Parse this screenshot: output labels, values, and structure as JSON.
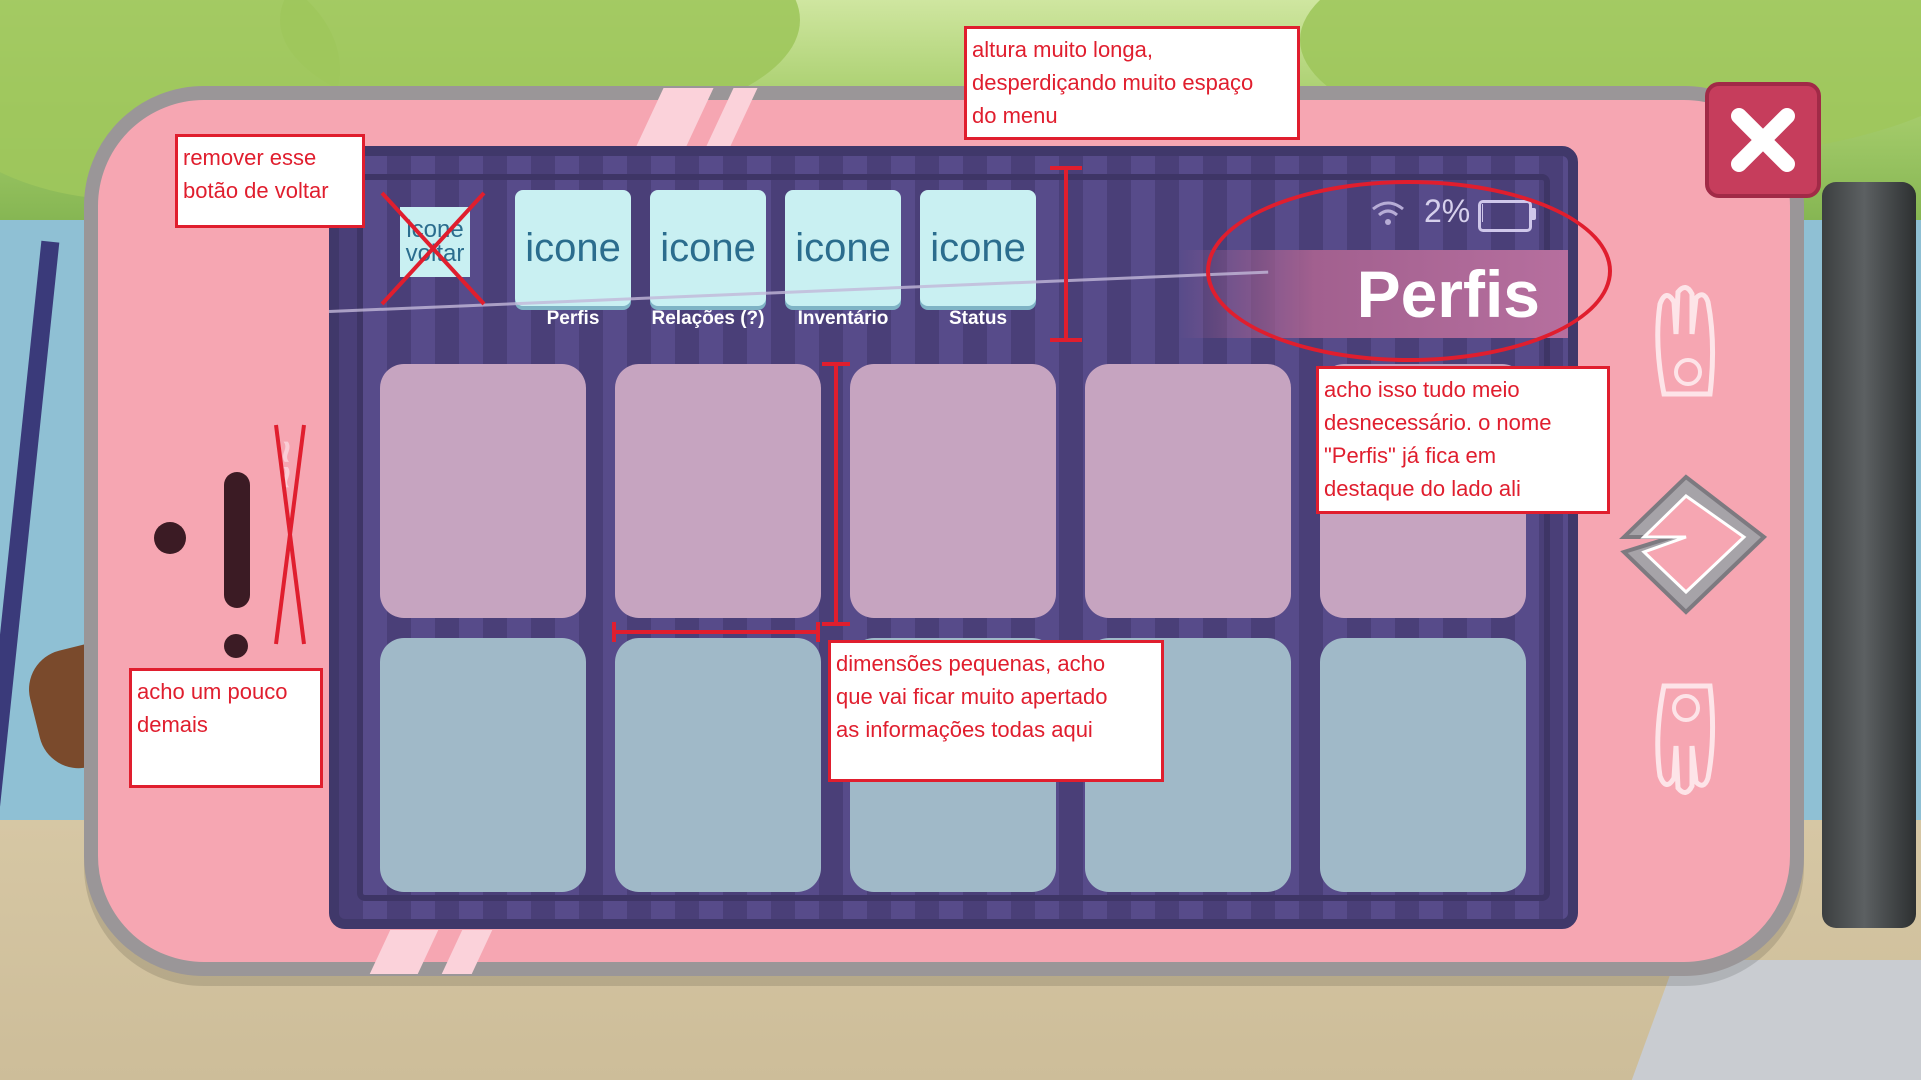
{
  "screen": {
    "back_button_label": "icone voltar",
    "tabs": [
      {
        "icon_text": "icone",
        "label": "Perfis"
      },
      {
        "icon_text": "icone",
        "label": "Relações (?)"
      },
      {
        "icon_text": "icone",
        "label": "Inventário"
      },
      {
        "icon_text": "icone",
        "label": "Status"
      }
    ],
    "battery_text": "2%",
    "battery_level": 0.02,
    "page_title": "Perfis"
  },
  "annotations": {
    "top": "altura muito longa,\ndesperdiçando muito espaço\ndo menu",
    "back": "remover esse\nbotão de voltar",
    "header": "acho isso tudo meio\ndesnecessário. o nome\n\"Perfis\" já fica em\ndestaque do lado ali",
    "phone_logo": "acho um pouco\ndemais",
    "cards": "dimensões pequenas, acho\nque vai ficar muito apertado\nas informações todas aqui"
  },
  "colors": {
    "phone_body": "#f6a6b2",
    "screen_bg": "#4a3f78",
    "tab_button": "#c9f0f2",
    "annotation": "#e01e2e",
    "close_button": "#c63d5c"
  },
  "icons": [
    "close-icon",
    "wifi-icon",
    "battery-icon",
    "next-arrow-icon",
    "hand-up-icon",
    "hand-down-icon"
  ]
}
